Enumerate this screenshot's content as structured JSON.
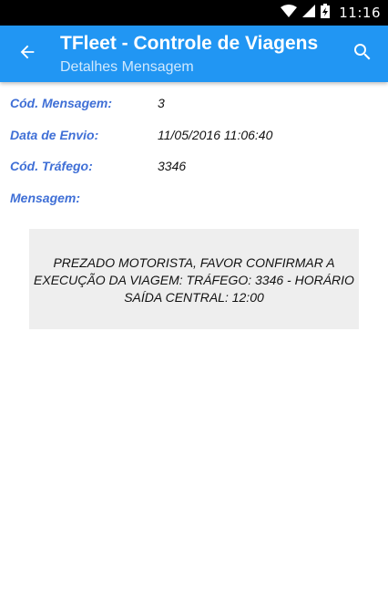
{
  "status_bar": {
    "time": "11:16",
    "icons": [
      "wifi-icon",
      "cell-signal-icon",
      "battery-charging-icon"
    ]
  },
  "app_bar": {
    "title": "TFleet - Controle de Viagens",
    "subtitle": "Detalhes Mensagem",
    "back_icon": "arrow-back-icon",
    "search_icon": "search-icon",
    "color": "#2196f3"
  },
  "details": {
    "codigo_label": "Cód. Mensagem:",
    "codigo_value": "3",
    "data_label": "Data de Envio:",
    "data_value": "11/05/2016 11:06:40",
    "trafego_label": "Cód. Tráfego:",
    "trafego_value": "3346",
    "mensagem_label": "Mensagem:"
  },
  "message": {
    "text": "PREZADO MOTORISTA, FAVOR CONFIRMAR A\nEXECUÇÃO DA VIAGEM:  TRÁFEGO: 3346 - HORÁRIO\nSAÍDA CENTRAL: 12:00"
  },
  "colors": {
    "label": "#3f6fd6",
    "message_background": "#eeeeee"
  }
}
